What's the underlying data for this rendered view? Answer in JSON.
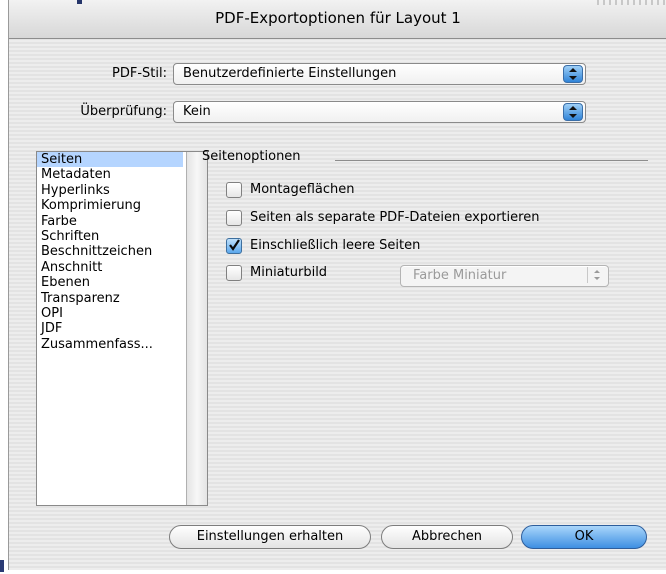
{
  "window": {
    "title": "PDF-Exportoptionen für Layout 1"
  },
  "style_row": {
    "label": "PDF-Stil:",
    "value": "Benutzerdefinierte Einstellungen"
  },
  "check_row": {
    "label": "Überprüfung:",
    "value": "Kein"
  },
  "sidebar": {
    "items": [
      {
        "label": "Seiten",
        "selected": true
      },
      {
        "label": "Metadaten"
      },
      {
        "label": "Hyperlinks"
      },
      {
        "label": "Komprimierung"
      },
      {
        "label": "Farbe"
      },
      {
        "label": "Schriften"
      },
      {
        "label": "Beschnittzeichen"
      },
      {
        "label": "Anschnitt"
      },
      {
        "label": "Ebenen"
      },
      {
        "label": "Transparenz"
      },
      {
        "label": "OPI"
      },
      {
        "label": "JDF"
      },
      {
        "label": "Zusammenfass..."
      }
    ]
  },
  "page_options": {
    "title": "Seitenoptionen",
    "options": [
      {
        "label": "Montageflächen",
        "checked": false
      },
      {
        "label": "Seiten als separate PDF-Dateien exportieren",
        "checked": false
      },
      {
        "label": "Einschließlich leere Seiten",
        "checked": true
      },
      {
        "label": "Miniaturbild",
        "checked": false
      }
    ],
    "thumbnail_select": {
      "value": "Farbe Miniatur",
      "enabled": false
    }
  },
  "buttons": {
    "keep": "Einstellungen erhalten",
    "cancel": "Abbrechen",
    "ok": "OK"
  }
}
